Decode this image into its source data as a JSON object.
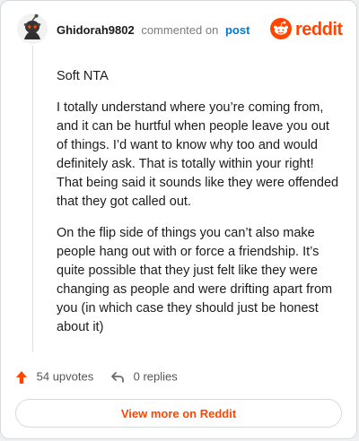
{
  "comment": {
    "author": "Ghidorah9802",
    "commented_text": "commented on",
    "post_link": "post",
    "paragraphs": [
      "Soft NTA",
      "I totally understand where you’re coming from, and it can be hurtful when people leave you out of things. I’d want to know why too and would definitely ask. That is totally within your right! That being said it sounds like they were offended that they got called out.",
      "On the flip side of things you can’t also make people hang out with or force a friendship. It’s quite possible that they just felt like they were changing as people and were drifting apart from you (in which case they should just be honest about it)"
    ],
    "upvotes_label": "54 upvotes",
    "replies_label": "0 replies",
    "view_more_label": "View more on Reddit"
  },
  "brand": {
    "wordmark": "reddit",
    "accent_color": "#ff4500",
    "link_color": "#0079d3"
  },
  "icons": {
    "avatar": "snoo-avatar-icon",
    "logo": "reddit-logo-icon",
    "upvote": "upvote-arrow-icon",
    "reply": "reply-arrow-icon"
  }
}
